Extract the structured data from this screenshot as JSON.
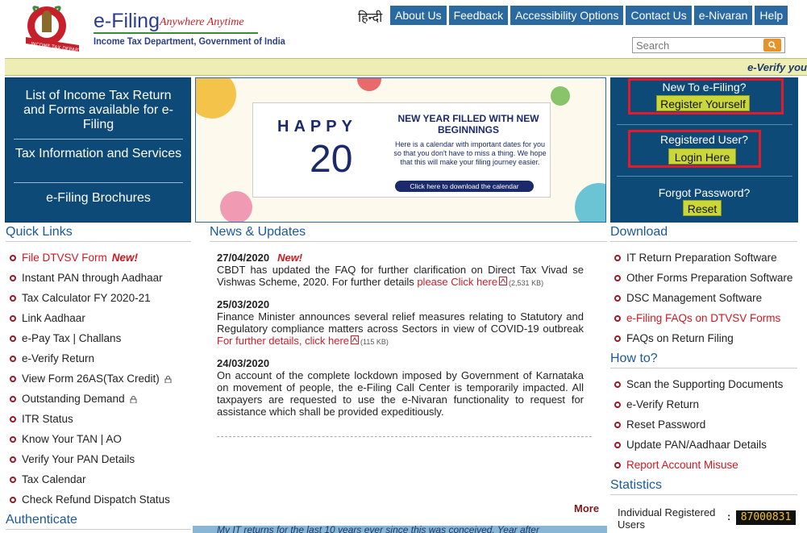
{
  "header": {
    "title": "e-Filing",
    "tagline": "Anywhere Anytime",
    "department": "Income Tax Department, Government of India",
    "hindi_link": "हिन्दी",
    "nav": [
      "About Us",
      "Feedback",
      "Accessibility Options",
      "Contact Us",
      "e-Nivaran",
      "Help"
    ],
    "search_placeholder": "Search",
    "ticker": "e-Verify you"
  },
  "left_panel": {
    "items": [
      "List of Income Tax Return and Forms available for e-Filing",
      "Tax Information and Services",
      "e-Filing Brochures"
    ]
  },
  "banner": {
    "happy": "HAPPY",
    "year": "20",
    "headline": "NEW YEAR FILLED WITH NEW BEGINNINGS",
    "text": "Here is a calendar with important dates for you so that you don't have to miss a thing. We hope that this will make your filing journey easier.",
    "button": "Click here to download the calendar"
  },
  "right_panel": {
    "new_label": "New To e-Filing?",
    "register_button": "Register Yourself",
    "registered_label": "Registered User?",
    "login_button": "Login Here",
    "forgot_label": "Forgot Password?",
    "reset_button": "Reset"
  },
  "quick_links": {
    "heading": "Quick Links",
    "new_tag": "New!",
    "items": [
      "File DTVSV Form",
      "Instant PAN through Aadhaar",
      "Tax Calculator FY 2020-21",
      "Link Aadhaar",
      "e-Pay Tax | Challans",
      "e-Verify Return",
      "View Form 26AS(Tax Credit)",
      "Outstanding Demand",
      "ITR Status",
      "Know Your TAN | AO",
      "Verify Your PAN Details",
      "Tax Calendar",
      "Check Refund Dispatch Status"
    ]
  },
  "authenticate": {
    "heading": "Authenticate"
  },
  "news": {
    "heading": "News & Updates",
    "new_tag": "New!",
    "items": [
      {
        "date": "27/04/2020",
        "body": "CBDT has updated the FAQ for further clarification on Direct Tax Vivad se Vishwas Scheme, 2020. For further details ",
        "link": "please Click here",
        "size": "(2,531 KB)"
      },
      {
        "date": "25/03/2020",
        "body": "Finance Minister announces several relief measures relating to Statutory and Regulatory compliance matters across Sectors in view of COVID-19 outbreak ",
        "link": "For further details, click here",
        "size": "(115 KB)"
      },
      {
        "date": "24/03/2020",
        "body": "On account of the complete lockdown imposed by Government of Karnataka on movement of people, the e-Filing Call Center is temporarily impacted. All taxpayers are requested to use the e-Nivaran functionality to request for assistance which shall be provided expeditiously.",
        "link": "",
        "size": ""
      }
    ],
    "more": "More",
    "bottom_strip": "My IT returns for the last 10 years ever since this was conceived. Year after"
  },
  "download": {
    "heading": "Download",
    "items": [
      "IT Return Preparation Software",
      "Other Forms Preparation Software",
      "DSC Management Software",
      "e-Filing FAQs on DTVSV Forms",
      "FAQs on Return Filing"
    ]
  },
  "how_to": {
    "heading": "How to?",
    "items": [
      "Scan the Supporting Documents",
      "e-Verify Return",
      "Reset Password",
      "Update PAN/Aadhaar Details",
      "Report Account Misuse"
    ]
  },
  "statistics": {
    "heading": "Statistics",
    "label": "Individual Registered Users",
    "colon": ":",
    "counter": "87000831"
  },
  "colors": {
    "nav_blue": "#2a6aa0",
    "panel_blue": "#0e4a78",
    "accent_red": "#d01820",
    "button_green": "#cbd63a"
  }
}
